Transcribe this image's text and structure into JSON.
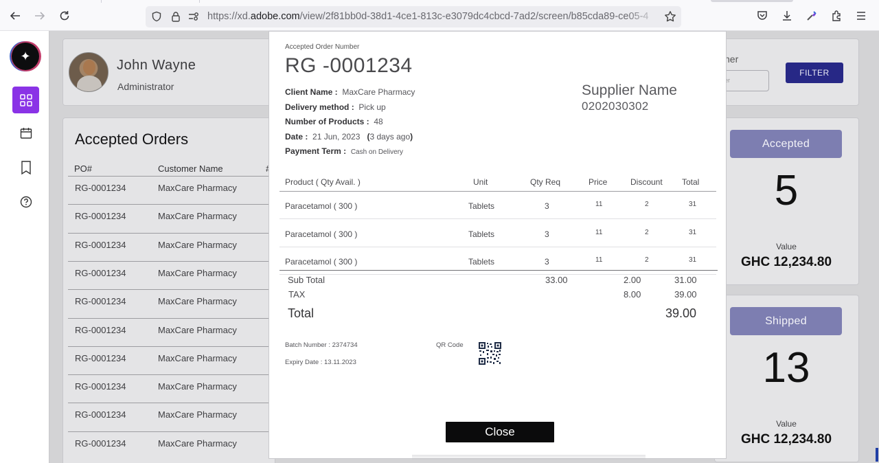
{
  "browser": {
    "url_prefix": "https://xd.",
    "url_domain": "adobe.com",
    "url_path": "/view/2f81bb0d-38d1-4ce1-813c-e3079dc4cbcd-7ad2/screen/b85cda89-ce05-4"
  },
  "profile": {
    "name": "John Wayne",
    "role": "Administrator"
  },
  "filter": {
    "label_fragment": "her",
    "input_fragment": "er",
    "button": "FILTER"
  },
  "orders": {
    "title": "Accepted Orders",
    "columns": [
      "PO#",
      "Customer Name",
      "#"
    ],
    "rows": [
      {
        "po": "RG-0001234",
        "customer": "MaxCare Pharmacy"
      },
      {
        "po": "RG-0001234",
        "customer": "MaxCare Pharmacy"
      },
      {
        "po": "RG-0001234",
        "customer": "MaxCare Pharmacy"
      },
      {
        "po": "RG-0001234",
        "customer": "MaxCare Pharmacy"
      },
      {
        "po": "RG-0001234",
        "customer": "MaxCare Pharmacy"
      },
      {
        "po": "RG-0001234",
        "customer": "MaxCare Pharmacy"
      },
      {
        "po": "RG-0001234",
        "customer": "MaxCare Pharmacy"
      },
      {
        "po": "RG-0001234",
        "customer": "MaxCare Pharmacy"
      },
      {
        "po": "RG-0001234",
        "customer": "MaxCare Pharmacy"
      },
      {
        "po": "RG-0001234",
        "customer": "MaxCare Pharmacy"
      }
    ]
  },
  "stats": [
    {
      "badge": "Accepted",
      "count": "5",
      "value_label": "Value",
      "value": "GHC 12,234.80"
    },
    {
      "badge": "Shipped",
      "count": "13",
      "value_label": "Value",
      "value": "GHC 12,234.80"
    }
  ],
  "modal": {
    "order_label": "Accepted Order Number",
    "order_number": "RG -0001234",
    "client_label": "Client Name :",
    "client_value": "MaxCare Pharmacy",
    "delivery_label": "Delivery method :",
    "delivery_value": "Pick up",
    "products_label": "Number  of Products :",
    "products_value": "48",
    "date_label": "Date :",
    "date_value": "21 Jun, 2023",
    "date_ago": "3 days ago",
    "paren_open": "(",
    "paren_close": ")",
    "payment_label": "Payment Term :",
    "payment_value": "Cash on Delivery",
    "supplier_name": "Supplier Name",
    "supplier_number": "0202030302",
    "table_headers": {
      "product": "Product   ( Qty Avail. )",
      "unit": "Unit",
      "qty": "Qty Req",
      "price": "Price",
      "discount": "Discount",
      "total": "Total"
    },
    "items": [
      {
        "product": "Paracetamol  ( 300 )",
        "unit": "Tablets",
        "qty": "3",
        "price": "11",
        "discount": "2",
        "total": "31"
      },
      {
        "product": "Paracetamol  ( 300 )",
        "unit": "Tablets",
        "qty": "3",
        "price": "11",
        "discount": "2",
        "total": "31"
      },
      {
        "product": "Paracetamol  ( 300 )",
        "unit": "Tablets",
        "qty": "3",
        "price": "11",
        "discount": "2",
        "total": "31"
      }
    ],
    "subtotal": {
      "label": "Sub Total",
      "qty": "33.00",
      "discount": "2.00",
      "total": "31.00"
    },
    "tax": {
      "label": "TAX",
      "discount": "8.00",
      "total": "39.00"
    },
    "grand_total": {
      "label": "Total",
      "value": "39.00"
    },
    "batch": "Batch Number : 2374734",
    "expiry": "Expiry Date : 13.11.2023",
    "qr_label": "QR Code",
    "close": "Close"
  },
  "colors": {
    "accent_purple": "#8a33e6",
    "filter_button": "#272886",
    "stat_badge": "#7d7eb1"
  }
}
